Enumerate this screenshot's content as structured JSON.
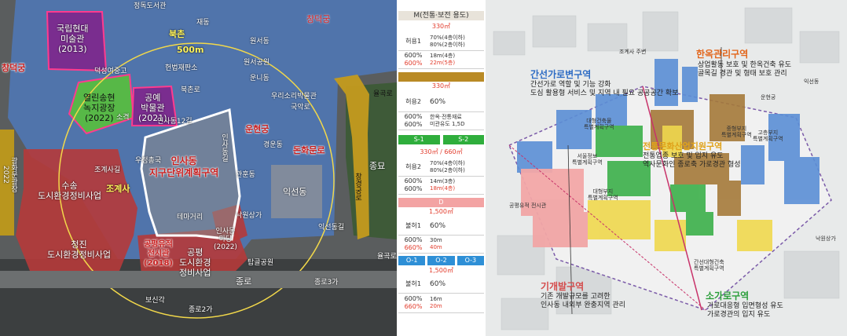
{
  "map": {
    "labels_top": [
      "정독도서관",
      "재동",
      "창덕궁",
      "북촌",
      "500m",
      "원서공원",
      "헌법재판소",
      "덕성여중고"
    ],
    "museum": "국립현대\n미술관\n(2013)",
    "plaza": "열린송현\n녹지광장\n(2022)",
    "craft": "공예\n박물관\n(2021)",
    "district": "인사동\n지구단위계획구역",
    "unhyeon": "운현궁",
    "donhwa": "돈화문로",
    "iksun": "익선동",
    "jogyesa": "조계사",
    "susong": "수송\n도시환경정비사업",
    "gongpyeong_sites": "공평유적\n전시관\n(2018)",
    "gongpyeong": "공평\n도시환경\n정비사업",
    "cheongjin": "청진\n도시환경정비사업",
    "insa_madang": "인사동\n마당\n(2022)",
    "theme_street": "테마거리",
    "left_edge_top": "창덕궁",
    "left_edge": "광화문광장\n2022",
    "jongro": "종로",
    "jongmyo": "종묘",
    "right_road": "율곡로",
    "right_road2": "창경궁로",
    "bosingak": "보신각",
    "tapgol": "탑골공원",
    "small_labels": [
      "우정총국",
      "소격",
      "원서동",
      "조계사길",
      "우리소리박물관",
      "국악로",
      "낙원상가",
      "인사동길",
      "운니동",
      "익선동길",
      "관훈동",
      "경운동",
      "종로2가",
      "종로3가",
      "인사동12길",
      "북촌로",
      "율곡로"
    ]
  },
  "table": {
    "header": "M(전통·보전 용도)",
    "sections": [
      {
        "area": "330㎡",
        "color": "#d9d3c7",
        "name": "허용1",
        "r1": [
          "70%(4층이하)",
          "80%(2층이하)"
        ],
        "r2a": "600%",
        "r2b": "600%",
        "h1": "18m(4층)",
        "h2": "22m(5층)"
      },
      {
        "area": "330㎡",
        "color": "#c79a2e",
        "name": "허용2",
        "cov": "60%",
        "r2a": "600%",
        "r2b": "600%",
        "n1": "한옥·전통재료",
        "n2": "미관유도 1,5D"
      },
      {
        "area": "330㎡ / 660㎡",
        "color": "#2fae3c",
        "tags": [
          "S-1",
          "S-2"
        ],
        "name": "허용2",
        "r1": [
          "70%(4층이하)",
          "80%(2층이하)"
        ],
        "r2a": "600%",
        "r2b": "600%",
        "h1": "14m(3층)",
        "h2": "18m(4층)"
      },
      {
        "area": "1,500㎡",
        "color": "#e97d7d",
        "label": "D",
        "name": "불허1",
        "cov": "60%",
        "r2a": "600%",
        "r2b": "660%",
        "h1": "30m",
        "h2": "40m"
      },
      {
        "area": "1,500㎡",
        "color": "#2e8fd6",
        "tags": [
          "O-1",
          "O-2",
          "O-3"
        ],
        "name": "불허1",
        "cov": "60%",
        "r2a": "600%",
        "r2b": "660%",
        "h1": "16m",
        "h2": "20m"
      }
    ],
    "unit_label": "기준",
    "max_label": "최대"
  },
  "render": {
    "hanok_title": "한옥관리구역",
    "hanok_desc": "상업활동 보호 및 한옥건축 유도\n골목길 경관 및 형태 보호 관리",
    "arterial_title": "간선가로변구역",
    "arterial_desc": "간선가로 역할 및 기능 강화\n도심 활용형 서비스 및 지역 내 필요 공공공간 확보",
    "center_title": "전통문화산업지원구역",
    "center_desc": "전통업종 보호 및 입지 유도\n역사문화인 종로축 가로경관 형성",
    "dev_title": "기개발구역",
    "dev_desc": "기존 개발규모를 고려한\n인사동 내외부 완충지역 관리",
    "small_title": "소가로구역",
    "small_desc": "가로대응형 입면형성 유도\n가로경관의 입지 유도",
    "site_labels": [
      "조계사 주변",
      "공평유적 전시관",
      "운현궁",
      "낙원상가",
      "익선동"
    ],
    "plot_labels": [
      "대형건축물\n특별계획구역",
      "대형부지\n특별계획구역",
      "중형부지\n특별계획구역",
      "고층부지\n특별계획구역",
      "서울정보\n특별계획구역",
      "간선대형건축\n특별계획구역"
    ]
  },
  "colors": {
    "blue": "#5b8fd6",
    "red": "#c04040",
    "green": "#3cb04a",
    "purple": "#7a2d8f",
    "yellow": "#e6d24a",
    "ochre": "#b9961e"
  }
}
